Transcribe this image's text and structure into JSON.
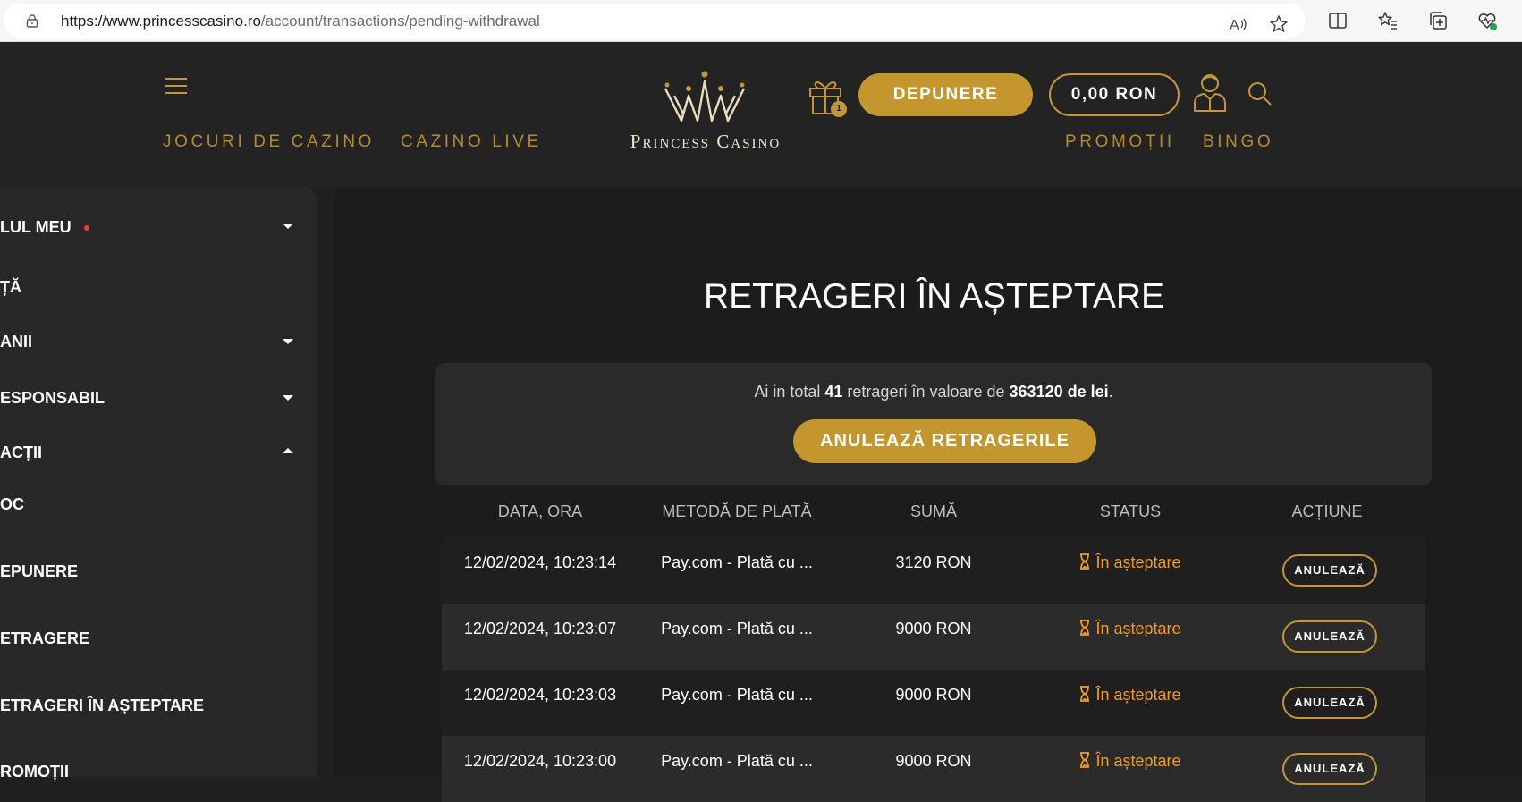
{
  "browser": {
    "url_host": "https://www.princesscasino.ro",
    "url_path": "/account/transactions/pending-withdrawal"
  },
  "header": {
    "nav_left": [
      "JOCURI DE CAZINO",
      "CAZINO LIVE"
    ],
    "nav_right": [
      "PROMOȚII",
      "BINGO"
    ],
    "logo_text": "Princess Casino",
    "gift_badge": "1",
    "deposit_label": "DEPUNERE",
    "balance": "0,00 RON"
  },
  "sidebar": {
    "items": [
      {
        "label": "LUL MEU",
        "expand": "down",
        "dot": true
      },
      {
        "label": "ȚĂ"
      },
      {
        "label": "ANII",
        "expand": "down"
      },
      {
        "label": "ESPONSABIL",
        "expand": "down"
      },
      {
        "label": "ACȚII",
        "expand": "up"
      },
      {
        "label": "OC"
      },
      {
        "label": "EPUNERE"
      },
      {
        "label": "ETRAGERE"
      },
      {
        "label": "ETRAGERI ÎN AȘTEPTARE"
      },
      {
        "label": "ROMOȚII"
      }
    ]
  },
  "main": {
    "title": "RETRAGERI ÎN AȘTEPTARE",
    "summary": {
      "prefix": "Ai in total ",
      "count": "41",
      "middle": " retrageri în valoare de ",
      "amount": "363120 de lei",
      "suffix": "."
    },
    "cancel_all_label": "ANULEAZĂ RETRAGERILE",
    "columns": [
      "DATA, ORA",
      "METODĂ DE PLATĂ",
      "SUMĂ",
      "STATUS",
      "ACȚIUNE"
    ],
    "rows": [
      {
        "datetime": "12/02/2024, 10:23:14",
        "method": "Pay.com - Plată cu ...",
        "amount": "3120 RON",
        "status": "În așteptare",
        "action": "ANULEAZĂ"
      },
      {
        "datetime": "12/02/2024, 10:23:07",
        "method": "Pay.com - Plată cu ...",
        "amount": "9000 RON",
        "status": "În așteptare",
        "action": "ANULEAZĂ"
      },
      {
        "datetime": "12/02/2024, 10:23:03",
        "method": "Pay.com - Plată cu ...",
        "amount": "9000 RON",
        "status": "În așteptare",
        "action": "ANULEAZĂ"
      },
      {
        "datetime": "12/02/2024, 10:23:00",
        "method": "Pay.com - Plată cu ...",
        "amount": "9000 RON",
        "status": "În așteptare",
        "action": "ANULEAZĂ"
      }
    ]
  },
  "colors": {
    "gold": "#c3962e",
    "status_orange": "#f29b2a",
    "background": "#1c1c1c",
    "panel": "#2a2a2a"
  },
  "icons": [
    "lock-icon",
    "read-aloud-icon",
    "favorite-star-icon",
    "split-screen-icon",
    "favorites-icon",
    "collections-icon",
    "browser-health-icon",
    "menu-icon",
    "crown-logo-icon",
    "gift-icon",
    "user-icon",
    "search-icon",
    "hourglass-icon",
    "chevron-down-icon",
    "chevron-up-icon"
  ]
}
